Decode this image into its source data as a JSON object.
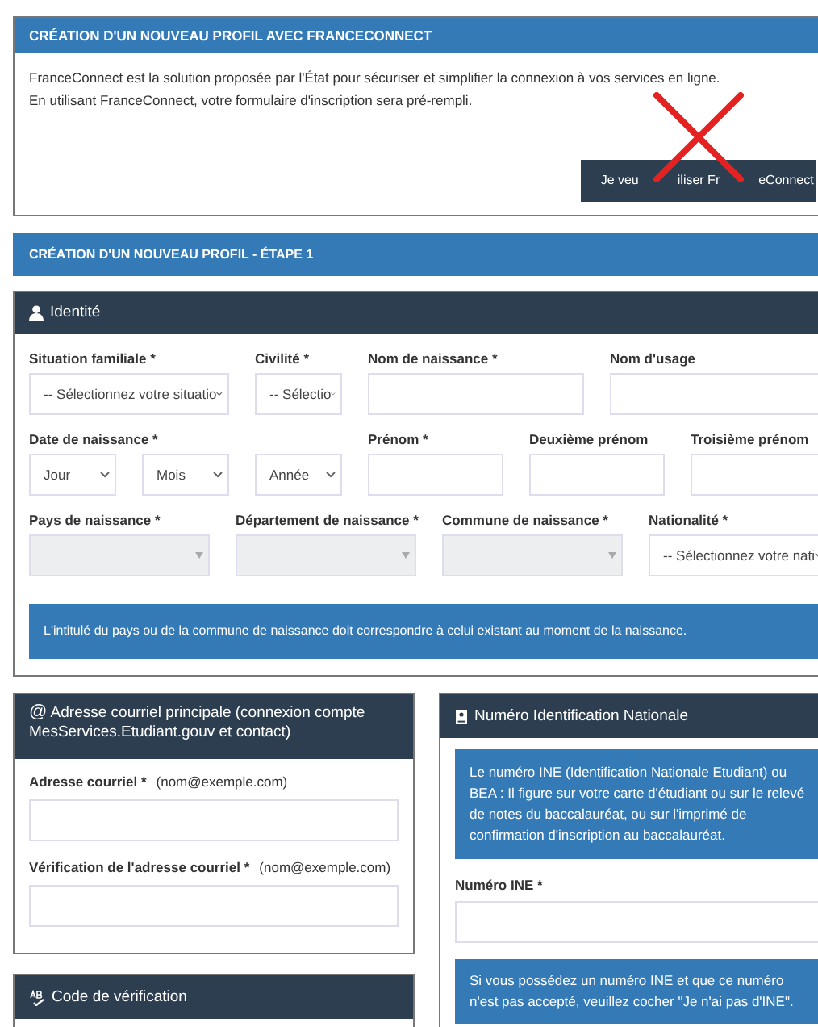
{
  "franceconnect": {
    "title": "CRÉATION D'UN NOUVEAU PROFIL AVEC FRANCECONNECT",
    "lines": [
      "FranceConnect est la solution proposée par l'État pour sécuriser et simplifier la connexion à vos services en ligne.",
      "En utilisant FranceConnect, votre formulaire d'inscription sera pré-rempli."
    ],
    "button_fragments": [
      "Je veu",
      "iliser Fr",
      "eConnect"
    ]
  },
  "step_banner": "CRÉATION D'UN NOUVEAU PROFIL - ÉTAPE 1",
  "identity": {
    "title": "Identité",
    "rows": [
      [
        {
          "kind": "select",
          "label": "Situation familiale *",
          "value": "-- Sélectionnez votre situatio",
          "disabled": false
        },
        {
          "kind": "select",
          "label": "Civilité *",
          "value": "-- Sélectio",
          "disabled": false
        },
        {
          "kind": "input",
          "label": "Nom de naissance *"
        },
        {
          "kind": "input",
          "label": "Nom d'usage"
        }
      ],
      [
        {
          "kind": "date",
          "label": "Date de naissance *",
          "parts": [
            {
              "value": "Jour",
              "disabled": false
            },
            {
              "value": "Mois",
              "disabled": false
            },
            {
              "value": "Année",
              "disabled": false
            }
          ]
        },
        {
          "kind": "input",
          "label": "Prénom *"
        },
        {
          "kind": "input",
          "label": "Deuxième prénom"
        },
        {
          "kind": "input",
          "label": "Troisième prénom"
        }
      ],
      [
        {
          "kind": "select",
          "label": "Pays de naissance *",
          "disabled": true
        },
        {
          "kind": "select",
          "label": "Département de naissance *",
          "disabled": true
        },
        {
          "kind": "select",
          "label": "Commune de naissance *",
          "disabled": true
        },
        {
          "kind": "select",
          "label": "Nationalité *",
          "value": "-- Sélectionnez votre nati",
          "disabled": false
        }
      ]
    ],
    "notice": "L'intitulé du pays ou de la commune de naissance doit correspondre à celui existant au moment de la naissance."
  },
  "email": {
    "icon": "@",
    "title": "Adresse courriel principale (connexion compte MesServices.Etudiant.gouv et contact)",
    "fields": [
      {
        "label": "Adresse courriel *",
        "hint": "(nom@exemple.com)"
      },
      {
        "label": "Vérification de l'adresse courriel *",
        "hint": "(nom@exemple.com)"
      }
    ]
  },
  "code": {
    "title": "Code de vérification"
  },
  "ine": {
    "title": "Numéro Identification Nationale",
    "info": "Le numéro INE (Identification Nationale Etudiant) ou BEA : Il figure sur votre carte d'étudiant ou sur le relevé de notes du baccalauréat, ou sur l'imprimé de confirmation d'inscription au baccalauréat.",
    "field_label": "Numéro INE *",
    "notice": "Si vous possédez un numéro INE et que ce numéro n'est pas accepté, veuillez cocher \"Je n'ai pas d'INE\"."
  }
}
